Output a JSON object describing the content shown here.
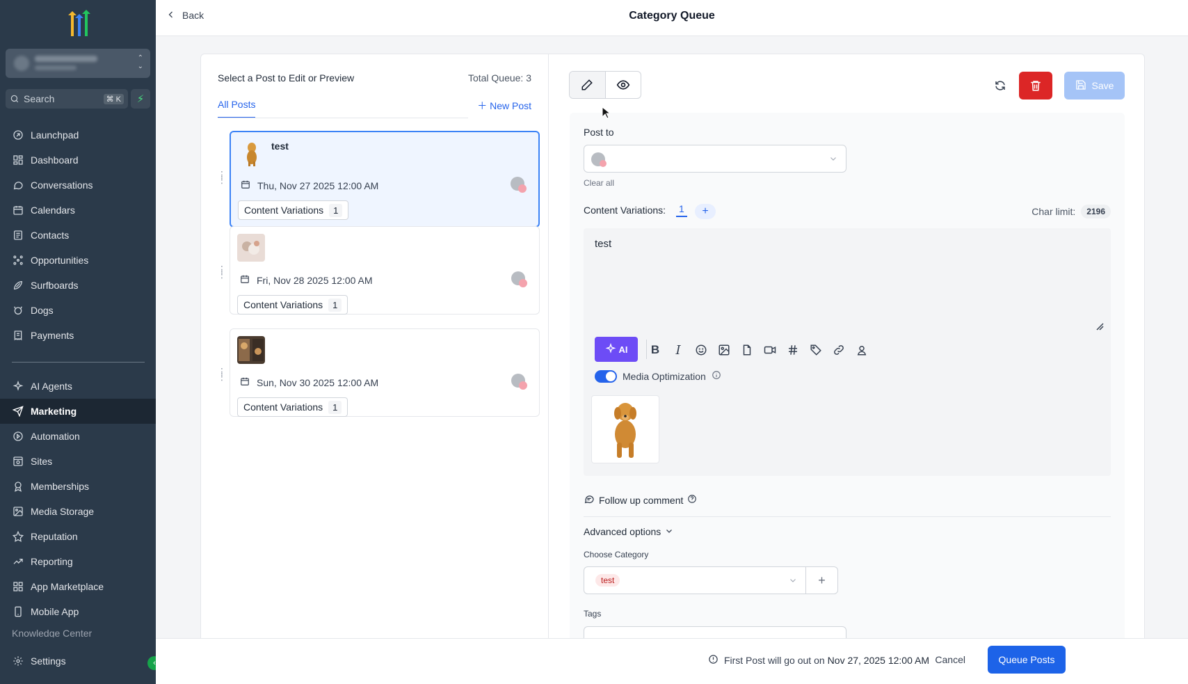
{
  "sidebar": {
    "search": {
      "label": "Search",
      "shortcut": "⌘ K"
    },
    "items": [
      {
        "label": "Launchpad",
        "icon": "rocket-icon"
      },
      {
        "label": "Dashboard",
        "icon": "grid-icon"
      },
      {
        "label": "Conversations",
        "icon": "chat-icon"
      },
      {
        "label": "Calendars",
        "icon": "calendar-icon"
      },
      {
        "label": "Contacts",
        "icon": "contacts-icon"
      },
      {
        "label": "Opportunities",
        "icon": "opportunities-icon"
      },
      {
        "label": "Surfboards",
        "icon": "surfboard-icon"
      },
      {
        "label": "Dogs",
        "icon": "dog-icon"
      },
      {
        "label": "Payments",
        "icon": "receipt-icon"
      }
    ],
    "items2": [
      {
        "label": "AI Agents",
        "icon": "sparkle-icon"
      },
      {
        "label": "Marketing",
        "icon": "send-icon",
        "active": true
      },
      {
        "label": "Automation",
        "icon": "automation-icon"
      },
      {
        "label": "Sites",
        "icon": "sites-icon"
      },
      {
        "label": "Memberships",
        "icon": "award-icon"
      },
      {
        "label": "Media Storage",
        "icon": "image-icon"
      },
      {
        "label": "Reputation",
        "icon": "star-icon"
      },
      {
        "label": "Reporting",
        "icon": "trend-icon"
      },
      {
        "label": "App Marketplace",
        "icon": "apps-icon"
      },
      {
        "label": "Mobile App",
        "icon": "phone-icon"
      }
    ],
    "faded_item": "Knowledge Center",
    "settings_label": "Settings"
  },
  "header": {
    "back_label": "Back",
    "title": "Category Queue"
  },
  "left_panel": {
    "title": "Select a Post to Edit or Preview",
    "total": "Total Queue: 3",
    "tab_all": "All Posts",
    "new_post": "New Post",
    "posts": [
      {
        "name": "test",
        "date": "Thu, Nov 27 2025 12:00 AM",
        "cv_label": "Content Variations",
        "cv_count": "1"
      },
      {
        "name": "",
        "date": "Fri, Nov 28 2025 12:00 AM",
        "cv_label": "Content Variations",
        "cv_count": "1"
      },
      {
        "name": "",
        "date": "Sun, Nov 30 2025 12:00 AM",
        "cv_label": "Content Variations",
        "cv_count": "1"
      }
    ]
  },
  "editor": {
    "save_label": "Save",
    "post_to_label": "Post to",
    "clear_all": "Clear all",
    "content_variations_label": "Content Variations:",
    "variation_tab": "1",
    "char_limit_label": "Char limit:",
    "char_limit_value": "2196",
    "content_text": "test",
    "ai_label": "AI",
    "media_optimization": "Media Optimization",
    "follow_up": "Follow up comment",
    "advanced": "Advanced options",
    "choose_category": "Choose Category",
    "category_value": "test",
    "tags_label": "Tags"
  },
  "footer": {
    "info_prefix": "First Post will go out on",
    "info_date": "Nov 27, 2025 12:00 AM",
    "cancel_label": "Cancel",
    "queue_label": "Queue Posts"
  },
  "colors": {
    "sidebar": "#2b3a4a",
    "primary": "#1d63e8",
    "danger": "#dc2626",
    "ai": "#6d4cf6"
  }
}
